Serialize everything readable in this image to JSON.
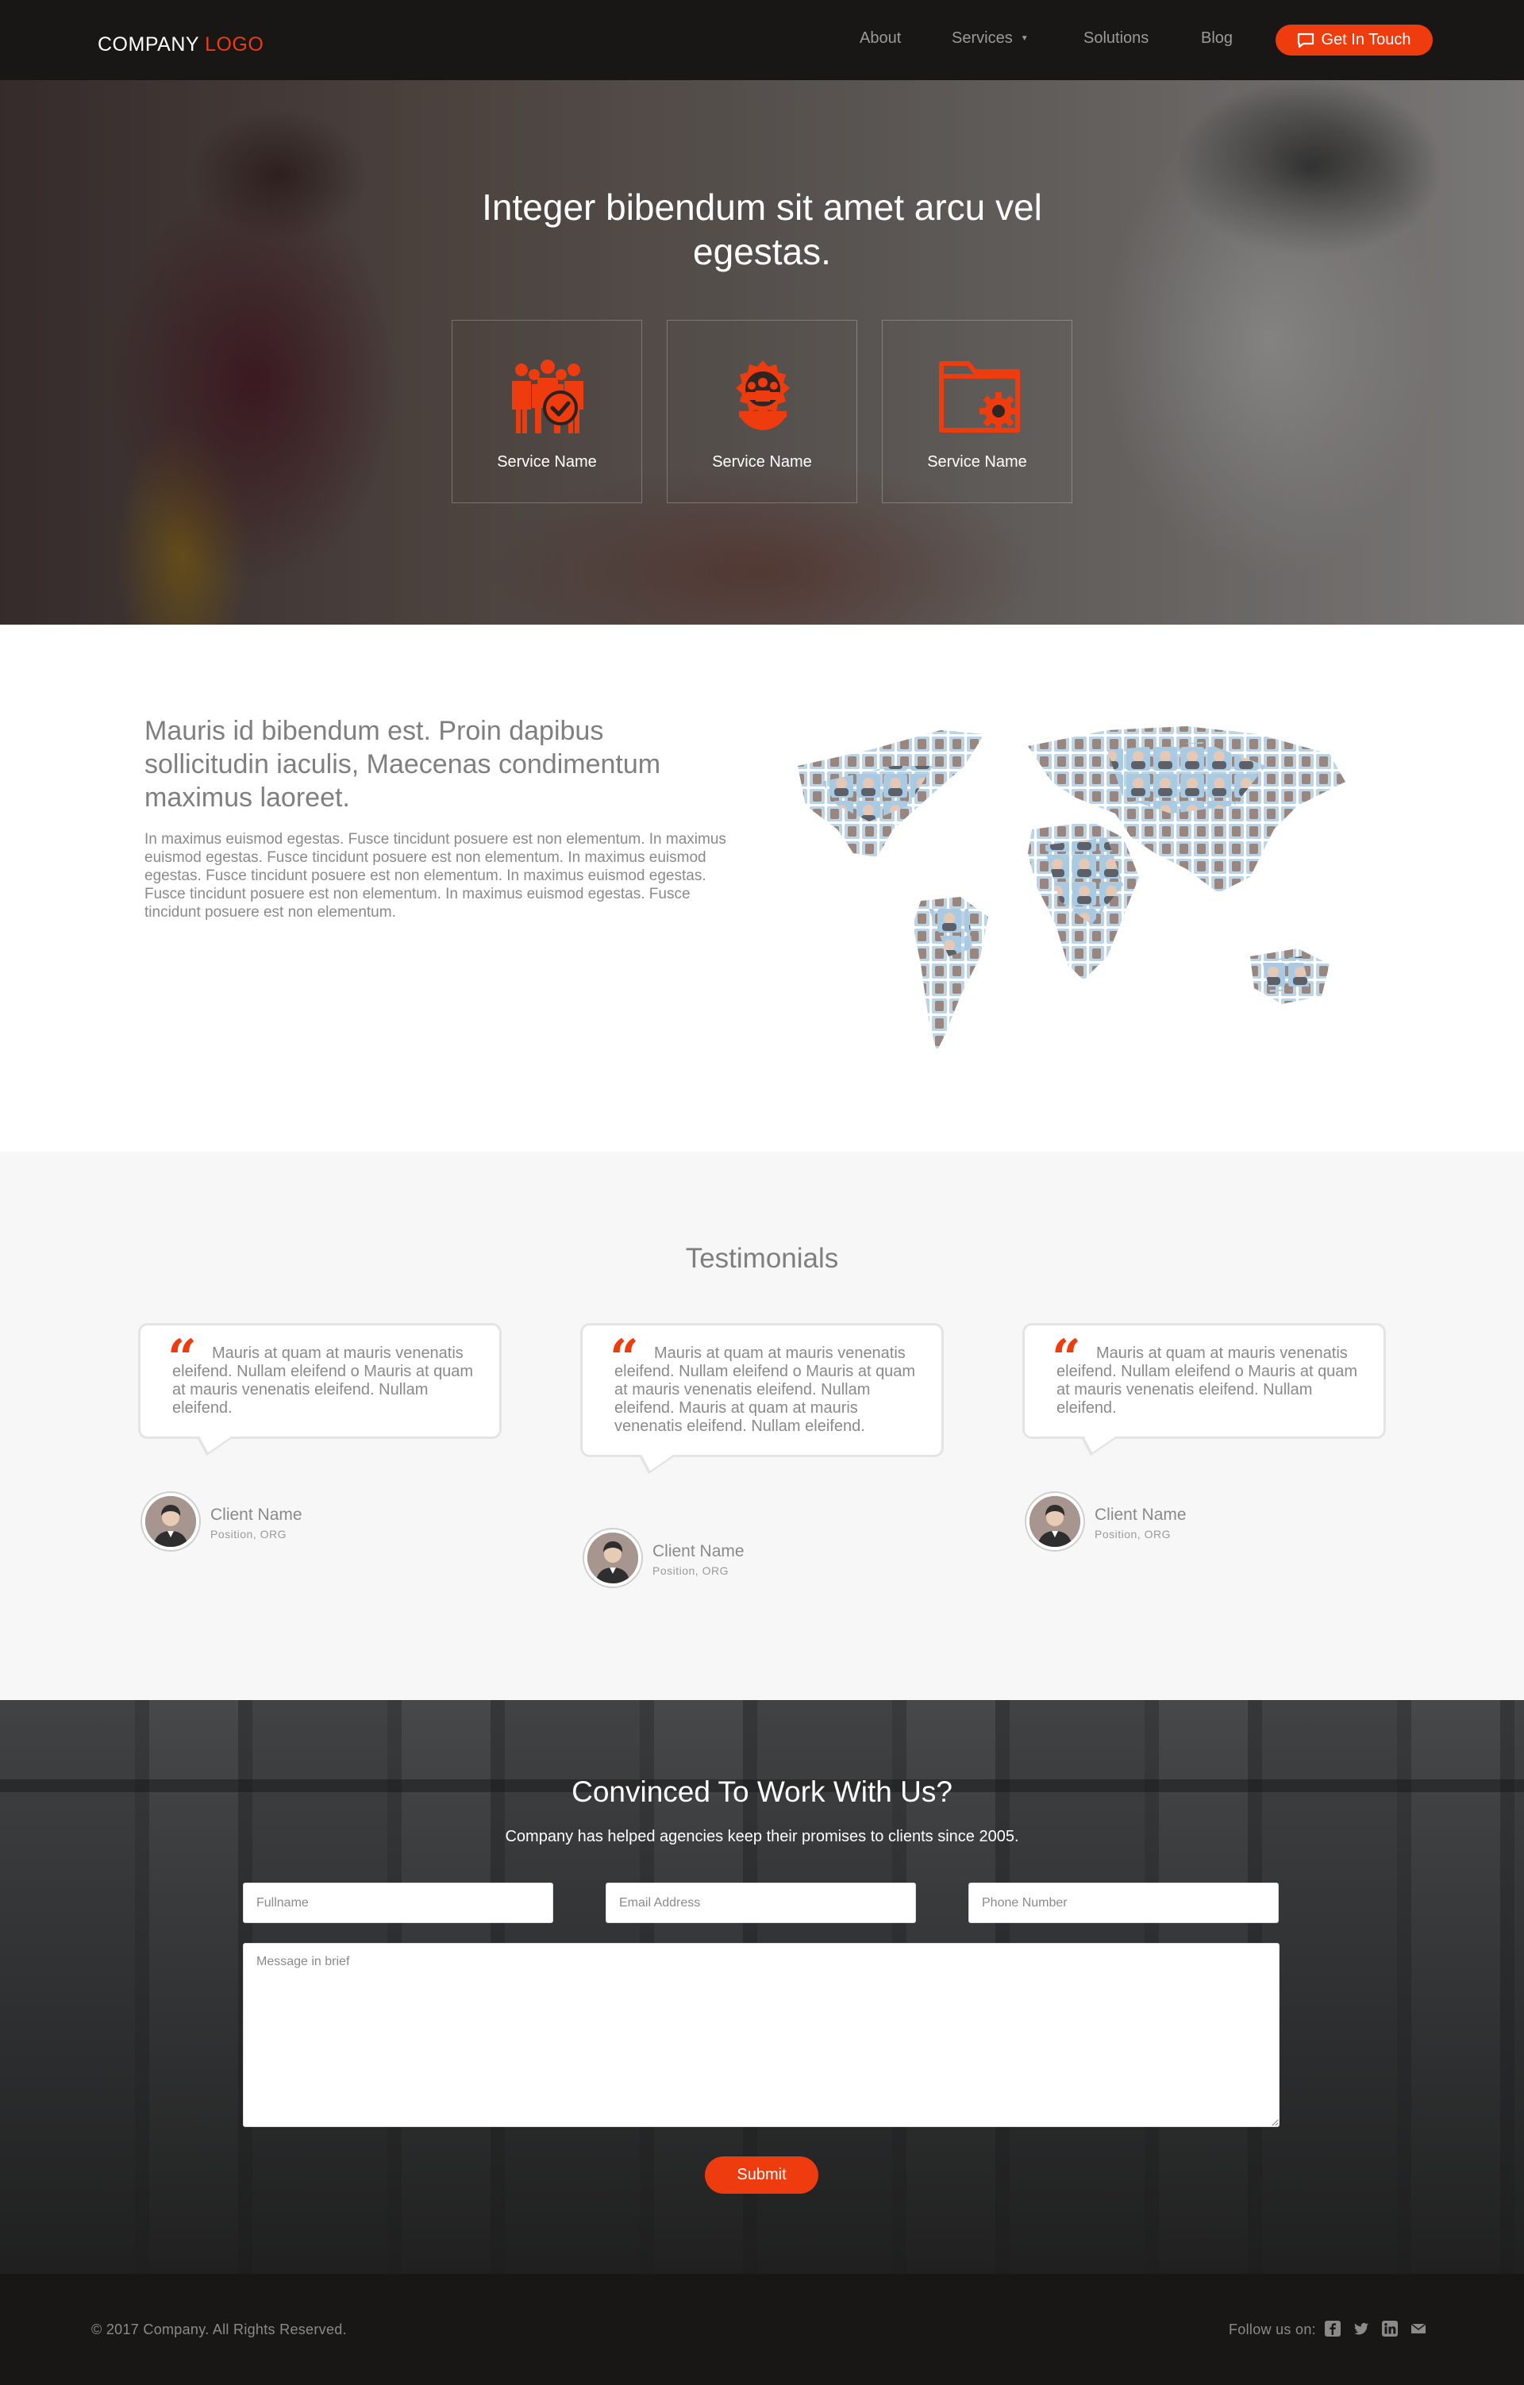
{
  "colors": {
    "accent": "#ee3c0e",
    "nav_bg": "#191715",
    "testimonials_bg": "#f7f7f7",
    "text_gray": "#7f7f7f"
  },
  "nav": {
    "logo_primary": "COMPANY",
    "logo_accent": "LOGO",
    "links": [
      "About",
      "Services",
      "Solutions",
      "Blog"
    ],
    "cta_label": "Get In Touch",
    "cta_icon": "chat-bubble-icon",
    "services_caret_icon": "caret-down-icon"
  },
  "hero": {
    "title": "Integer bibendum sit amet arcu vel egestas.",
    "services": [
      {
        "label": "Service Name",
        "icon": "team-check-icon"
      },
      {
        "label": "Service Name",
        "icon": "gear-people-icon"
      },
      {
        "label": "Service Name",
        "icon": "folder-gear-icon"
      }
    ]
  },
  "about": {
    "title": "Mauris id bibendum est. Proin dapibus sollicitudin iaculis, Maecenas condimentum maximus laoreet.",
    "body": "In maximus euismod egestas. Fusce tincidunt posuere est non elementum. In maximus euismod egestas. Fusce tincidunt posuere est non elementum. In maximus euismod egestas. Fusce tincidunt posuere est non elementum. In maximus euismod egestas. Fusce tincidunt posuere est non elementum. In maximus euismod egestas. Fusce tincidunt posuere est non elementum."
  },
  "testimonials": {
    "title": "Testimonials",
    "items": [
      {
        "quote": "Mauris at quam at mauris venenatis eleifend. Nullam eleifend o Mauris at quam at mauris venenatis eleifend. Nullam eleifend.",
        "name": "Client Name",
        "position": "Position, ORG"
      },
      {
        "quote": "Mauris at quam at mauris venenatis eleifend. Nullam eleifend o Mauris at quam at mauris venenatis eleifend. Nullam eleifend. Mauris at quam at mauris venenatis eleifend. Nullam eleifend.",
        "name": "Client Name",
        "position": "Position, ORG"
      },
      {
        "quote": "Mauris at quam at mauris venenatis eleifend. Nullam eleifend o Mauris at quam at mauris venenatis eleifend. Nullam eleifend.",
        "name": "Client Name",
        "position": "Position, ORG"
      }
    ]
  },
  "contact": {
    "title": "Convinced To Work With Us?",
    "subtitle": "Company has helped agencies keep their promises to clients since 2005.",
    "fullname_placeholder": "Fullname",
    "email_placeholder": "Email Address",
    "phone_placeholder": "Phone Number",
    "message_placeholder": "Message in brief",
    "submit_label": "Submit"
  },
  "footer": {
    "copyright": "© 2017 Company. All Rights Reserved.",
    "follow_label": "Follow us on:",
    "social_icons": [
      "facebook-icon",
      "twitter-icon",
      "linkedin-icon",
      "email-icon"
    ]
  }
}
